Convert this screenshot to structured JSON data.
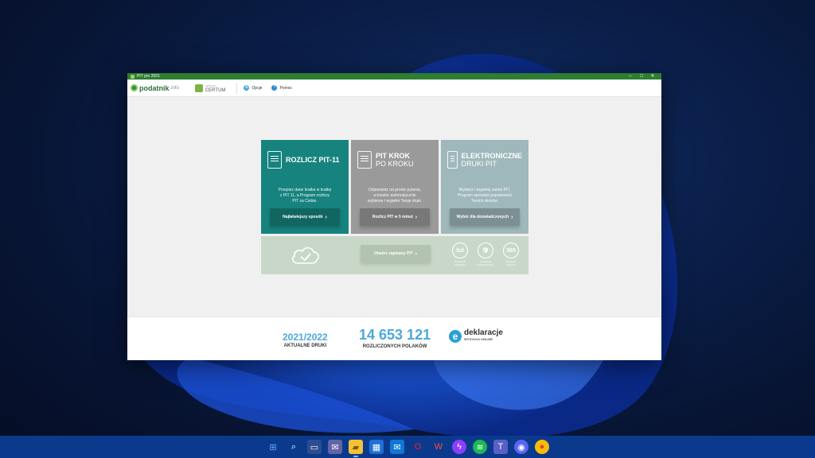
{
  "window": {
    "title": "PIT pro 2021",
    "controls": {
      "minimize": "–",
      "maximize": "□",
      "close": "✕"
    }
  },
  "toolbar": {
    "logo_text": "podatnik",
    "logo_suffix": ".info",
    "certum_small": "CERTUM",
    "certum_text": "CERTUM",
    "options_label": "Opcje",
    "help_label": "Pomoc"
  },
  "tiles": [
    {
      "title": "ROZLICZ PIT-11",
      "title_thin": "",
      "desc_lines": [
        "Przepisz dane kratka w kratkę",
        "z PIT 11, a Program rozliczy",
        "PIT za Ciebie."
      ],
      "button": "Najłatwiejszy sposób",
      "icon": "document-check-icon",
      "color": "#16837e"
    },
    {
      "title": "PIT KROK",
      "title_thin": "PO KROKU",
      "desc_lines": [
        "Odpowiedz na proste pytania,",
        "a kreator automatycznie",
        "wybierze i wypełni Twoje druki."
      ],
      "button": "Rozlicz PIT w 5 minut",
      "icon": "documents-steps-icon",
      "color": "#9a9a9a"
    },
    {
      "title": "ELEKTRONICZNE",
      "title_thin": "DRUKI PIT",
      "desc_lines": [
        "Wybierz i wypełnij sam/a PIT.",
        "Program sprawdzi poprawność",
        "Twoich druków."
      ],
      "button": "Wybór dla doświadczonych",
      "icon": "form-pen-icon",
      "color": "#9fb8bb"
    }
  ],
  "bottom": {
    "open_button": "Otwórz zapisany PIT",
    "badges": [
      {
        "value": "0zł",
        "label": "Całkowicie bezpłatnie"
      },
      {
        "value": "🛡",
        "label": "Gwarancja bezpieczeństwa"
      },
      {
        "value": "365",
        "label": "Wsparcie dostępne"
      }
    ]
  },
  "footer": {
    "year": "2021/2022",
    "year_label": "AKTUALNE DRUKI",
    "count": "14 653 121",
    "count_label": "ROZLICZONYCH POLAKÓW",
    "edek_name": "deklaracje",
    "edek_sub": "WYSYŁKA ONLINE"
  },
  "taskbar": {
    "icons": [
      "windows-start-icon",
      "search-icon",
      "task-view-icon",
      "teams-chat-icon",
      "file-explorer-icon",
      "store-icon",
      "mail-icon",
      "opera-icon",
      "office-icon",
      "messenger-icon",
      "spotify-icon",
      "teams-icon",
      "discord-icon",
      "chrome-icon"
    ]
  }
}
